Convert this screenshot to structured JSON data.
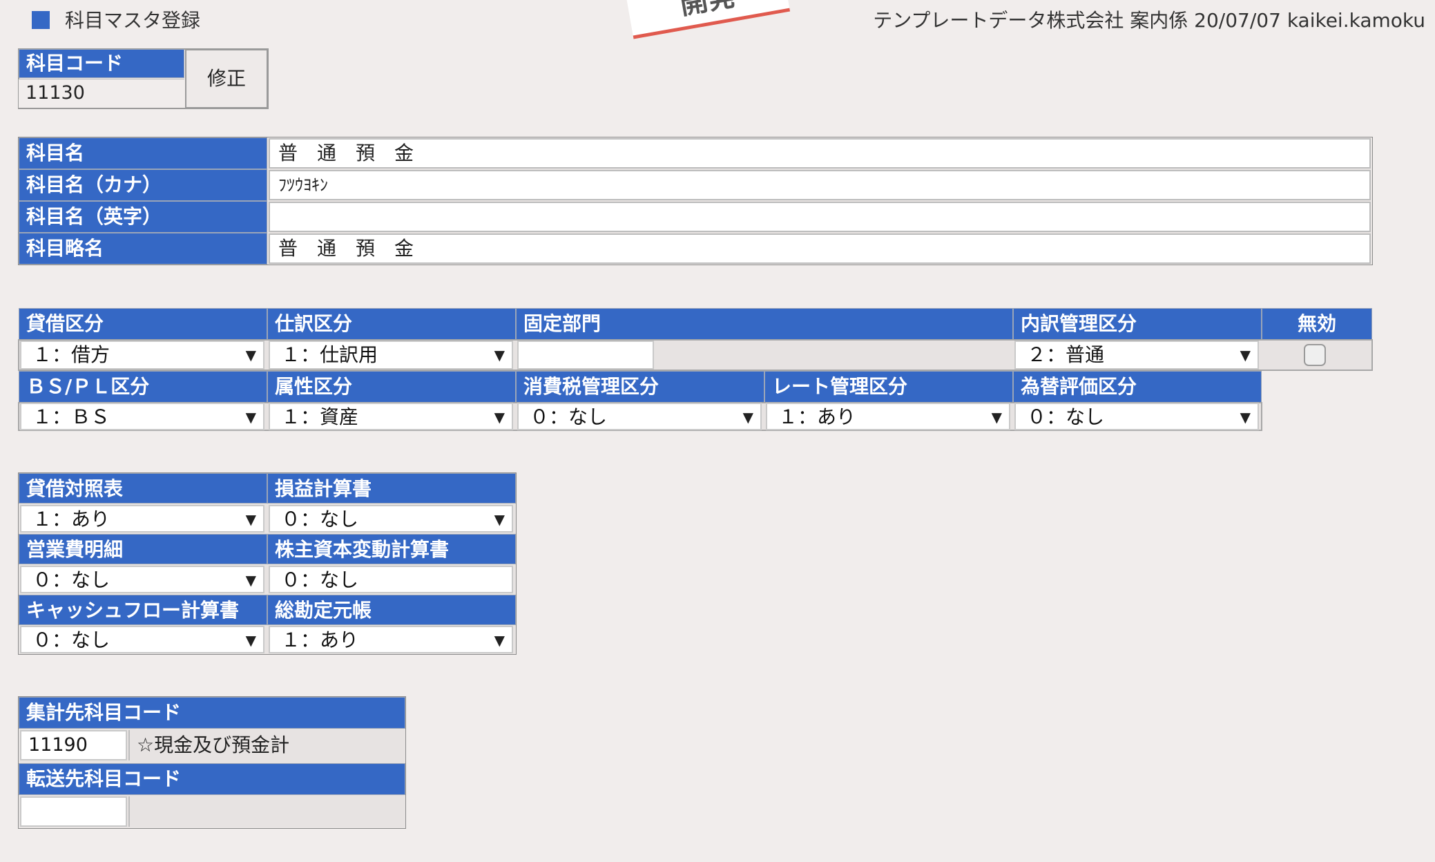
{
  "window": {
    "title": "科目マスタ登録",
    "header_info": "テンプレートデータ株式会社 案内係 20/07/07 kaikei.kamoku",
    "ribbon_text": "開発"
  },
  "code_box": {
    "label": "科目コード",
    "value": "11130",
    "edit_button": "修正"
  },
  "names": [
    {
      "label": "科目名",
      "value": "普　通　預　金"
    },
    {
      "label": "科目名（カナ）",
      "value": "ﾌﾂｳﾖｷﾝ"
    },
    {
      "label": "科目名（英字）",
      "value": ""
    },
    {
      "label": "科目略名",
      "value": "普　通　預　金"
    }
  ],
  "classification": {
    "row1": {
      "taishaku": {
        "label": "貸借区分",
        "value": "１：借方"
      },
      "shiwake": {
        "label": "仕訳区分",
        "value": "１：仕訳用"
      },
      "kotei_bumon": {
        "label": "固定部門",
        "value": ""
      },
      "uchiwake": {
        "label": "内訳管理区分",
        "value": "２：普通"
      },
      "mukou": {
        "label": "無効",
        "checked": false
      }
    },
    "row2": {
      "bspl": {
        "label": "ＢＳ/ＰＬ区分",
        "value": "１：ＢＳ"
      },
      "zokusei": {
        "label": "属性区分",
        "value": "１：資産"
      },
      "shohizei": {
        "label": "消費税管理区分",
        "value": "０：なし"
      },
      "rate": {
        "label": "レート管理区分",
        "value": "１：あり"
      },
      "kawase": {
        "label": "為替評価区分",
        "value": "０：なし"
      }
    }
  },
  "reports": [
    {
      "label": "貸借対照表",
      "value": "１：あり",
      "has_arrow": true
    },
    {
      "label": "損益計算書",
      "value": "０：なし",
      "has_arrow": true
    },
    {
      "label": "営業費明細",
      "value": "０：なし",
      "has_arrow": true
    },
    {
      "label": "株主資本変動計算書",
      "value": "０：なし",
      "has_arrow": false
    },
    {
      "label": "キャッシュフロー計算書",
      "value": "０：なし",
      "has_arrow": true
    },
    {
      "label": "総勘定元帳",
      "value": "１：あり",
      "has_arrow": true
    }
  ],
  "aggregate": {
    "label": "集計先科目コード",
    "code": "11190",
    "name": "☆現金及び預金計"
  },
  "transfer": {
    "label": "転送先科目コード",
    "code": "",
    "name": ""
  },
  "colors": {
    "header_blue": "#3568c5",
    "background": "#f1edec",
    "ribbon_red": "#e05a4e"
  }
}
